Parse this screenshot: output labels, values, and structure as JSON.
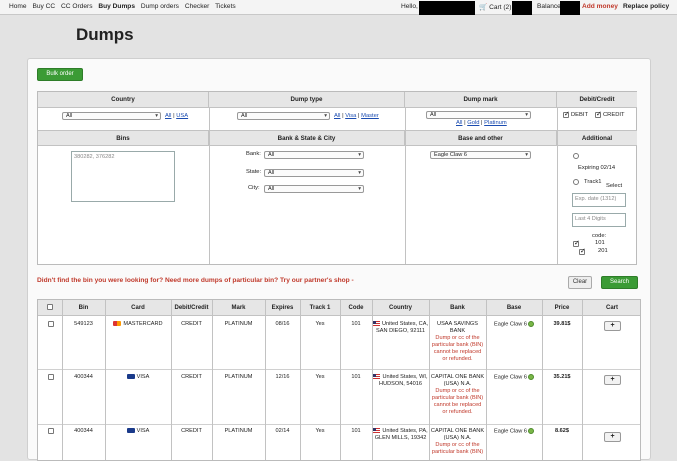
{
  "nav": {
    "items": [
      "Home",
      "Buy CC",
      "CC Orders",
      "Buy Dumps",
      "Dump orders",
      "Checker",
      "Tickets"
    ],
    "active_index": 3,
    "hello": "Hello,",
    "cart": "Cart (2)",
    "balance": "Balance",
    "add_money": "Add money",
    "replace_policy": "Replace policy"
  },
  "page": {
    "title": "Dumps",
    "bulk_order": "Bulk order"
  },
  "filters": {
    "headers": {
      "country": "Country",
      "dump_type": "Dump type",
      "dump_mark": "Dump mark",
      "debit_credit": "Debit/Credit",
      "bins": "Bins",
      "bank_state_city": "Bank & State & City",
      "base_other": "Base and other",
      "additional": "Additional"
    },
    "country_select": "All",
    "country_links": [
      "All",
      "USA"
    ],
    "dump_type_select": "All",
    "dump_type_links": [
      "All",
      "Visa",
      "Master"
    ],
    "dump_mark_select": "All",
    "dump_mark_links": [
      "All",
      "Gold",
      "Platinum"
    ],
    "debit_label": "DEBIT",
    "credit_label": "CREDIT",
    "bins_value": "380282, 376282",
    "bank_label": "Bank:",
    "bank_select": "All",
    "state_label": "State:",
    "state_select": "All",
    "city_label": "City:",
    "city_select": "All",
    "base_select": "Eagle Claw 6",
    "expiring_label": "Expiring 02/14",
    "track1_label": "Track1",
    "select_label": "Select",
    "exp_placeholder": "Exp. date (1312)",
    "last4_placeholder": "Last 4 Digits",
    "code_label": "code:",
    "code_101": "101",
    "code_201": "201"
  },
  "message": "Didn't find the bin you were looking for? Need more dumps of particular bin? Try our partner's shop -",
  "actions": {
    "clear": "Clear",
    "search": "Search"
  },
  "results": {
    "headers": [
      "",
      "Bin",
      "Card",
      "Debit/Credit",
      "Mark",
      "Expires",
      "Track 1",
      "Code",
      "Country",
      "Bank",
      "Base",
      "Price",
      "Cart"
    ],
    "cart_button": "+",
    "rows": [
      {
        "bin": "549123",
        "card": "MASTERCARD",
        "type": "CREDIT",
        "mark": "PLATINUM",
        "expires": "08/16",
        "track1": "Yes",
        "code": "101",
        "country_line1": "United States, CA,",
        "country_line2": "SAN DIEGO, 92111",
        "bank_name": "USAA SAVINGS",
        "bank_name2": "BANK",
        "bank_note": [
          "Dump or cc of the",
          "particular bank (BIN)",
          "cannot be replaced",
          "or refunded."
        ],
        "base": "Eagle Claw 6",
        "price": "39.81$"
      },
      {
        "bin": "400344",
        "card": "VISA",
        "type": "CREDIT",
        "mark": "PLATINUM",
        "expires": "12/16",
        "track1": "Yes",
        "code": "101",
        "country_line1": "United States, WI,",
        "country_line2": "HUDSON, 54016",
        "bank_name": "CAPITAL ONE BANK",
        "bank_name2": "(USA) N.A.",
        "bank_note": [
          "Dump or cc of the",
          "particular bank (BIN)",
          "cannot be replaced",
          "or refunded."
        ],
        "base": "Eagle Claw 6",
        "price": "35.21$"
      },
      {
        "bin": "400344",
        "card": "VISA",
        "type": "CREDIT",
        "mark": "PLATINUM",
        "expires": "02/14",
        "track1": "Yes",
        "code": "101",
        "country_line1": "United States, PA,",
        "country_line2": "GLEN MILLS, 19342",
        "bank_name": "CAPITAL ONE BANK",
        "bank_name2": "(USA) N.A.",
        "bank_note": [
          "Dump or cc of the",
          "particular bank (BIN)"
        ],
        "base": "Eagle Claw 6",
        "price": "8.62$"
      }
    ]
  },
  "colors": {
    "accent_green": "#3b9b35",
    "warning_red": "#c0392b",
    "link_blue": "#1a4bb0"
  }
}
